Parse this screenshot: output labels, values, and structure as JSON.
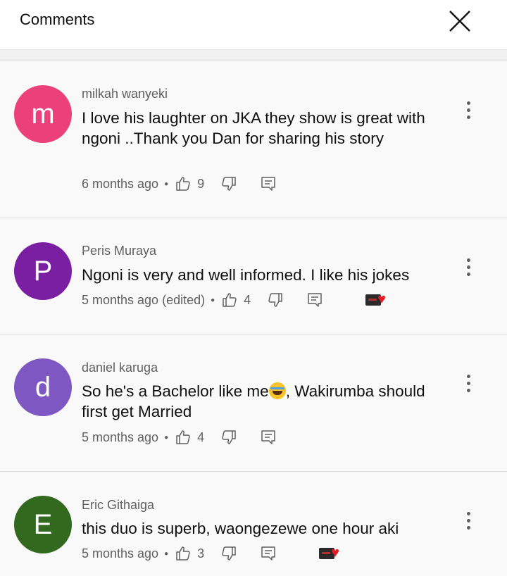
{
  "header": {
    "title": "Comments",
    "close_icon": "close-icon"
  },
  "comments": [
    {
      "author": "milkah wanyeki",
      "avatar_letter": "m",
      "avatar_color": "#ec407a",
      "text": "I love his laughter on JKA they show is great with ngoni ..Thank you  Dan for sharing his story",
      "time": "6 months ago",
      "likes": "9",
      "hearted": false
    },
    {
      "author": "Peris Muraya",
      "avatar_letter": "P",
      "avatar_color": "#7b1fa2",
      "text": "Ngoni is very and well informed. I like his jokes",
      "time": "5 months ago (edited)",
      "likes": "4",
      "hearted": true
    },
    {
      "author": "daniel karuga",
      "avatar_letter": "d",
      "avatar_color": "#7e57c2",
      "text_before": "So he's a Bachelor like me",
      "text_after": ", Wakirumba should first get Married",
      "emoji": "face-with-tears-of-joy",
      "time": "5 months ago",
      "likes": "4",
      "hearted": false
    },
    {
      "author": "Eric Githaiga",
      "avatar_letter": "E",
      "avatar_color": "#33691e",
      "text": "this duo is superb, waongezewe one hour aki",
      "time": "5 months ago",
      "likes": "3",
      "hearted": true
    }
  ],
  "icons": {
    "like": "thumbs-up-icon",
    "dislike": "thumbs-down-icon",
    "reply": "reply-icon",
    "more": "more-vert-icon",
    "heart": "creator-heart-icon"
  },
  "colors": {
    "heart": "#e31b23",
    "secondary_text": "#606060",
    "primary_text": "#0f0f0f"
  }
}
